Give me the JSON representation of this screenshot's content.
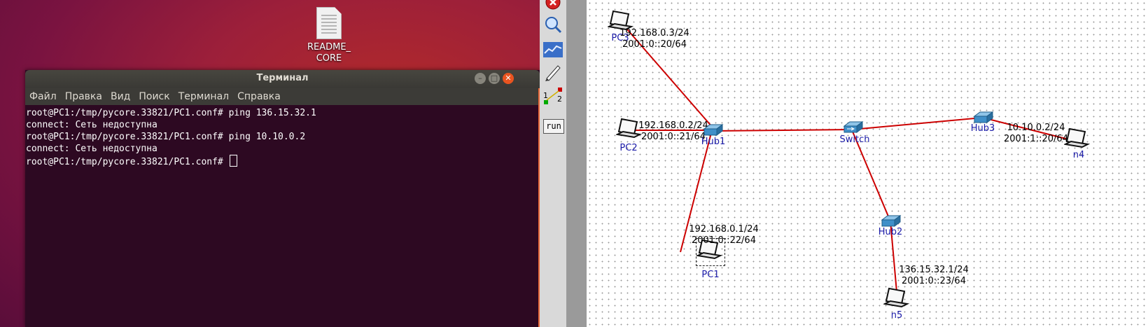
{
  "desktop": {
    "readme_icon": {
      "label_line1": "README_",
      "label_line2": "CORE",
      "icon": "text-file-icon"
    }
  },
  "terminal": {
    "title": "Терминал",
    "menu": [
      "Файл",
      "Правка",
      "Вид",
      "Поиск",
      "Терминал",
      "Справка"
    ],
    "lines": [
      "root@PC1:/tmp/pycore.33821/PC1.conf# ping 136.15.32.1",
      "connect: Сеть недоступна",
      "root@PC1:/tmp/pycore.33821/PC1.conf# ping 10.10.0.2",
      "connect: Сеть недоступна",
      "root@PC1:/tmp/pycore.33821/PC1.conf# "
    ],
    "colors": {
      "background": "#2d0922",
      "titlebar": "#3c3b37",
      "close": "#e95420"
    }
  },
  "toolbar": {
    "tools": [
      "close-icon",
      "zoom-icon",
      "plot-icon",
      "marker-icon",
      "two-node-icon"
    ],
    "two_node_labels": [
      "1",
      "2"
    ],
    "run_label": "run"
  },
  "topology": {
    "link_color": "#cc0000",
    "nodes": [
      {
        "name": "PC3",
        "kind": "laptop",
        "addr": [
          "192.168.0.3/24",
          "2001:0::20/64"
        ]
      },
      {
        "name": "PC2",
        "kind": "laptop",
        "addr": [
          "192.168.0.2/24",
          "2001:0::21/64"
        ]
      },
      {
        "name": "PC1",
        "kind": "laptop",
        "addr": [
          "192.168.0.1/24",
          "2001:0::22/64"
        ]
      },
      {
        "name": "Hub1",
        "kind": "hub",
        "addr": []
      },
      {
        "name": "Switch",
        "kind": "switch",
        "addr": []
      },
      {
        "name": "Hub3",
        "kind": "hub",
        "addr": []
      },
      {
        "name": "n4",
        "kind": "laptop",
        "addr": [
          "10.10.0.2/24",
          "2001:1::20/64"
        ]
      },
      {
        "name": "Hub2",
        "kind": "hub",
        "addr": []
      },
      {
        "name": "n5",
        "kind": "laptop",
        "addr": [
          "136.15.32.1/24",
          "2001:0::23/64"
        ]
      }
    ]
  }
}
